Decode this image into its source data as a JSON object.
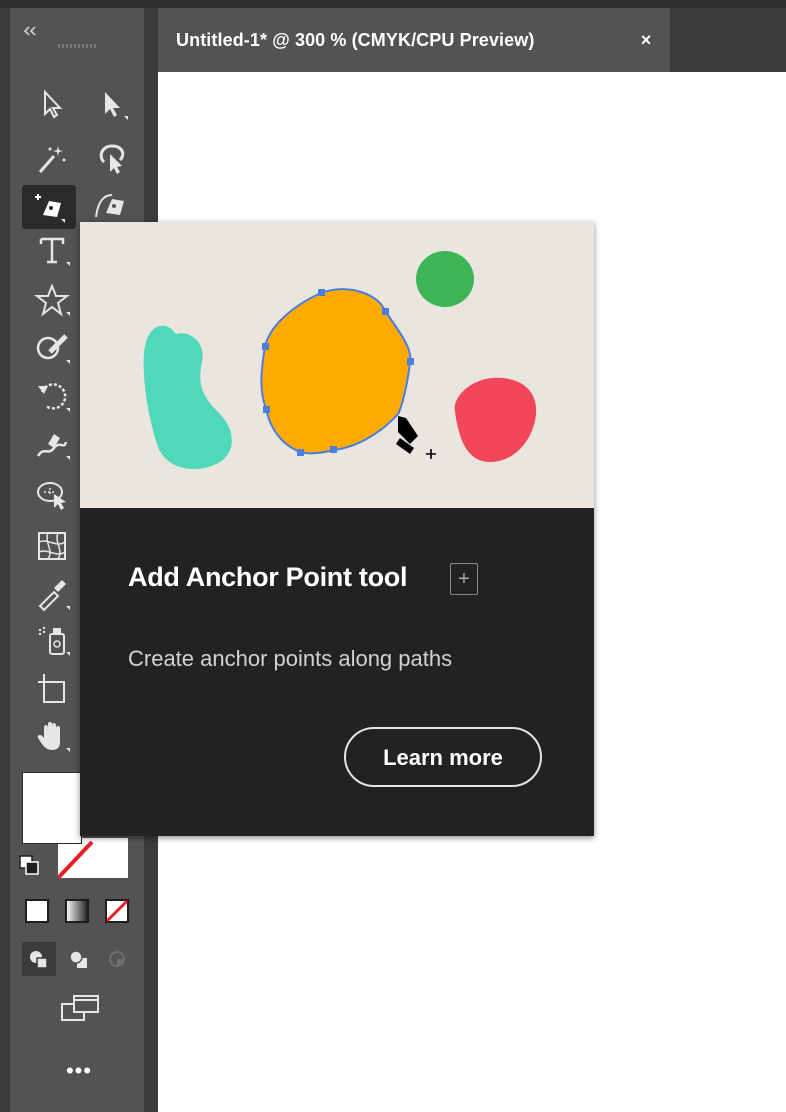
{
  "document_tab": {
    "title": "Untitled-1* @ 300 % (CMYK/CPU Preview)",
    "close_glyph": "×"
  },
  "toolbar": {
    "collapse_icon": "double-chevron-left-icon",
    "more_tools_label": "•••",
    "tools": [
      "direct-selection-icon",
      "selection-icon",
      "magic-wand-icon",
      "lasso-icon",
      "add-anchor-point-icon",
      "curvature-icon",
      "type-icon",
      "star-icon",
      "shaper-icon",
      "rotate-icon",
      "warp-icon",
      "free-transform-icon",
      "mesh-icon",
      "eyedropper-icon",
      "symbol-sprayer-icon",
      "artboard-icon",
      "hand-icon"
    ],
    "fill_color": "#ffffff",
    "stroke_color": "none"
  },
  "tooltip": {
    "title": "Add Anchor Point tool",
    "shortcut": "+",
    "description": "Create anchor points along paths",
    "button_label": "Learn more"
  },
  "colors": {
    "chrome_dark": "#3b3b3b",
    "panel": "#535353",
    "tooltip_bg": "#222222",
    "illustration_bg": "#ebe5e0",
    "teal_shape": "#4fd9b9",
    "orange_shape": "#ffaa00",
    "green_shape": "#3cb655",
    "red_shape": "#f2465a",
    "anchor_blue": "#4a7fe0"
  }
}
